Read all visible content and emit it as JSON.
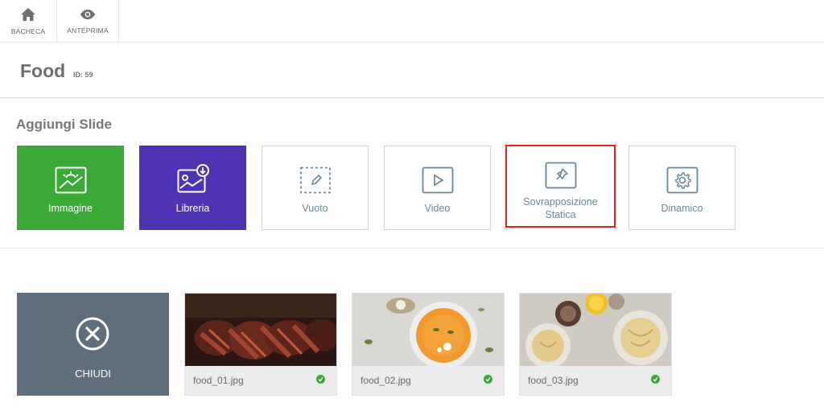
{
  "toolbar": {
    "home": {
      "label": "BACHECA",
      "icon": "home-icon"
    },
    "preview": {
      "label": "ANTEPRIMA",
      "icon": "eye-icon"
    }
  },
  "page": {
    "title": "Food",
    "id_label": "ID: 59"
  },
  "add_slide": {
    "heading": "Aggiungi Slide",
    "tiles": [
      {
        "label": "Immagine",
        "icon": "image-icon",
        "color": "#3aa935"
      },
      {
        "label": "Libreria",
        "icon": "library-icon",
        "color": "#4f32b4"
      },
      {
        "label": "Vuoto",
        "icon": "blank-edit-icon"
      },
      {
        "label": "Video",
        "icon": "video-play-icon"
      },
      {
        "label_line1": "Sovrapposizione",
        "label_line2": "Statica",
        "icon": "pin-icon",
        "selected": true
      },
      {
        "label": "Dinamico",
        "icon": "gear-icon"
      }
    ]
  },
  "media": {
    "close_label": "CHIUDI",
    "files": [
      {
        "name": "food_01.jpg",
        "status": "uploaded"
      },
      {
        "name": "food_02.jpg",
        "status": "uploaded"
      },
      {
        "name": "food_03.jpg",
        "status": "uploaded"
      }
    ]
  },
  "colors": {
    "accent_green": "#3aa935",
    "accent_purple": "#4f32b4",
    "close_bg": "#5f6e7c",
    "selection_red": "#e02424",
    "tile_text": "#6b8797"
  }
}
